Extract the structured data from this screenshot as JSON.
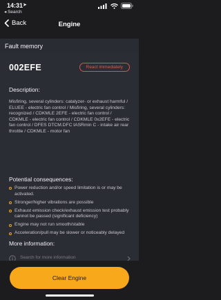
{
  "status_bar": {
    "time": "14:31",
    "back_app": "◂ Search"
  },
  "nav": {
    "back_label": "Back",
    "title": "Engine"
  },
  "section": {
    "title": "Fault memory"
  },
  "fault": {
    "code": "002EFE",
    "severity": "React immediately",
    "severity_color": "#d9534f",
    "description_title": "Description:",
    "description": "Misfiring, several cylinders: catalyzer- or exhaust harmful / ELUEE - electric fan control / Misfiring, several cylinders: recognized / CDKMLE 2EFE - electric fan control / CDKMLE - electric fan control / CDKMLE 0x2EFE - electric fan control / DFES DTCM.DFC tASRmin C - intake air rear throttle / CDKMLE - motor fan",
    "consequences_title": "Potential consequences:",
    "consequences": [
      "Power reduction and/or speed limitation is or may be activated.",
      "Stronger/higher vibrations are possible",
      "Exhaust emission check/exhaust emission test probably cannot be passed (significant deficiency)",
      "Engine may not run smooth/stable",
      "Acceleration/pull may be slower or noticeably delayed"
    ],
    "more_info_title": "More information:",
    "search_placeholder": "Search for more information"
  },
  "actions": {
    "clear_label": "Clear Engine"
  },
  "colors": {
    "accent": "#f7a81b",
    "background": "#1c1c1e",
    "card": "#2b2d34"
  }
}
